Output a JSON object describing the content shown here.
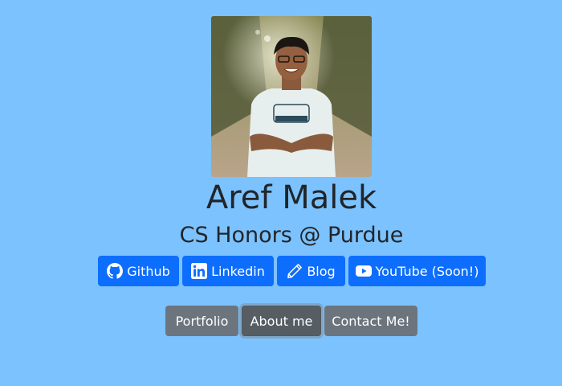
{
  "profile": {
    "name": "Aref Malek",
    "tagline": "CS Honors @ Purdue"
  },
  "social_links": [
    {
      "label": "Github",
      "icon": "github-icon"
    },
    {
      "label": "Linkedin",
      "icon": "linkedin-icon"
    },
    {
      "label": "Blog",
      "icon": "pencil-icon"
    },
    {
      "label": "YouTube (Soon!)",
      "icon": "youtube-icon"
    }
  ],
  "nav": {
    "items": [
      {
        "label": "Portfolio",
        "active": false
      },
      {
        "label": "About me",
        "active": true
      },
      {
        "label": "Contact Me!",
        "active": false
      }
    ]
  },
  "colors": {
    "background": "#7cc2fe",
    "primary": "#0d6efd",
    "secondary": "#6c757d",
    "secondary_active": "#565e64"
  }
}
